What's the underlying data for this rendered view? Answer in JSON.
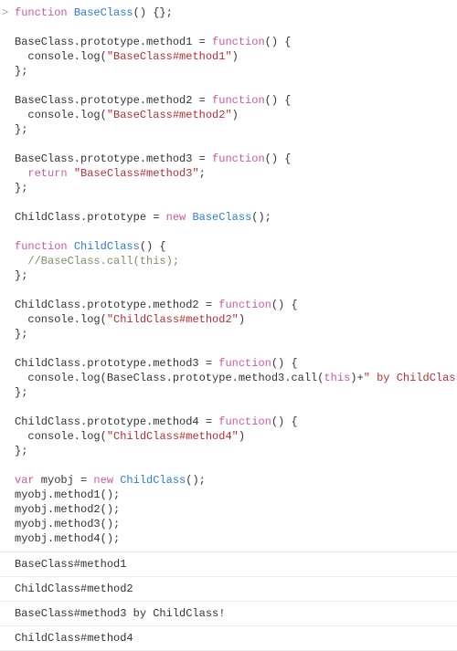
{
  "code": {
    "prompt": ">",
    "l01a": "function",
    "l01b": " ",
    "l01c": "BaseClass",
    "l01d": "() {};",
    "l03a": "BaseClass.prototype.method1 = ",
    "l03b": "function",
    "l03c": "() {",
    "l04a": "  console.log(",
    "l04b": "\"BaseClass#method1\"",
    "l04c": ")",
    "l05a": "};",
    "l07a": "BaseClass.prototype.method2 = ",
    "l07b": "function",
    "l07c": "() {",
    "l08a": "  console.log(",
    "l08b": "\"BaseClass#method2\"",
    "l08c": ")",
    "l09a": "};",
    "l11a": "BaseClass.prototype.method3 = ",
    "l11b": "function",
    "l11c": "() {",
    "l12a": "  ",
    "l12b": "return",
    "l12c": " ",
    "l12d": "\"BaseClass#method3\"",
    "l12e": ";",
    "l13a": "};",
    "l15a": "ChildClass.prototype = ",
    "l15b": "new",
    "l15c": " ",
    "l15d": "BaseClass",
    "l15e": "();",
    "l17a": "function",
    "l17b": " ",
    "l17c": "ChildClass",
    "l17d": "() {",
    "l18a": "  ",
    "l18b": "//BaseClass.call(this);",
    "l19a": "};",
    "l21a": "ChildClass.prototype.method2 = ",
    "l21b": "function",
    "l21c": "() {",
    "l22a": "  console.log(",
    "l22b": "\"ChildClass#method2\"",
    "l22c": ")",
    "l23a": "};",
    "l25a": "ChildClass.prototype.method3 = ",
    "l25b": "function",
    "l25c": "() {",
    "l26a": "  console.log(BaseClass.prototype.method3.call(",
    "l26b": "this",
    "l26c": ")+",
    "l26d": "\" by ChildClass!\"",
    "l26e": ");",
    "l27a": "};",
    "l29a": "ChildClass.prototype.method4 = ",
    "l29b": "function",
    "l29c": "() {",
    "l30a": "  console.log(",
    "l30b": "\"ChildClass#method4\"",
    "l30c": ")",
    "l31a": "};",
    "l33a": "var",
    "l33b": " myobj = ",
    "l33c": "new",
    "l33d": " ",
    "l33e": "ChildClass",
    "l33f": "();",
    "l34a": "myobj.method1();",
    "l35a": "myobj.method2();",
    "l36a": "myobj.method3();",
    "l37a": "myobj.method4();"
  },
  "output": {
    "o1": "BaseClass#method1",
    "o2": "ChildClass#method2",
    "o3": "BaseClass#method3 by ChildClass!",
    "o4": "ChildClass#method4"
  }
}
